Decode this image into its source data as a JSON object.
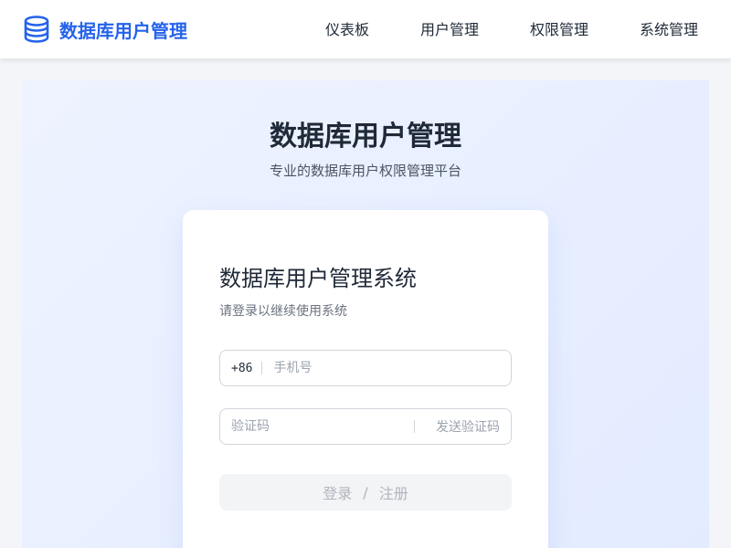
{
  "header": {
    "brand_title": "数据库用户管理",
    "brand_color": "#2563eb",
    "brand_icon": "database-icon",
    "nav": [
      {
        "label": "仪表板"
      },
      {
        "label": "用户管理"
      },
      {
        "label": "权限管理"
      },
      {
        "label": "系统管理"
      }
    ]
  },
  "hero": {
    "title": "数据库用户管理",
    "subtitle": "专业的数据库用户权限管理平台"
  },
  "login": {
    "title": "数据库用户管理系统",
    "subtitle": "请登录以继续使用系统",
    "phone": {
      "prefix": "+86",
      "placeholder": "手机号",
      "value": ""
    },
    "code": {
      "placeholder": "验证码",
      "value": "",
      "send_label": "发送验证码"
    },
    "submit": {
      "login_label": "登录",
      "separator": "/",
      "register_label": "注册"
    }
  }
}
